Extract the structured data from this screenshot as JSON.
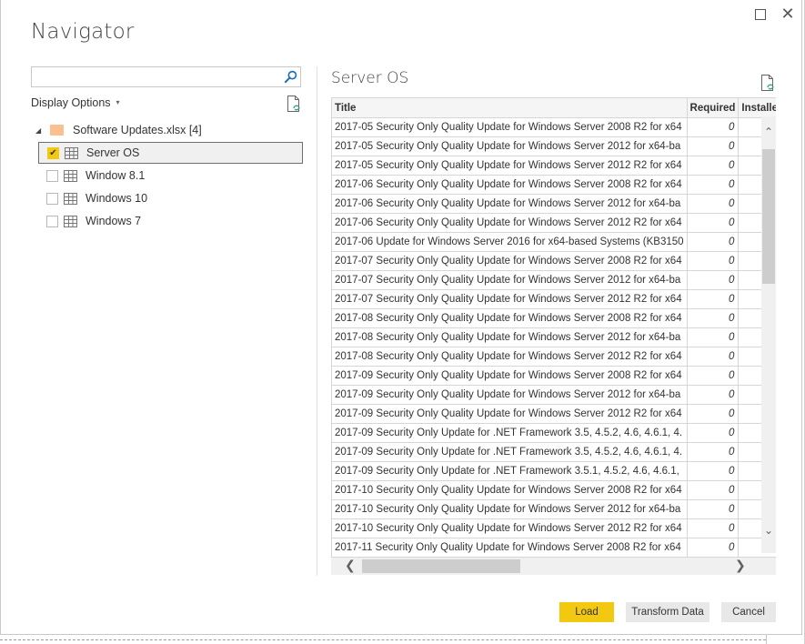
{
  "window": {
    "title": "Navigator",
    "maximize_icon": "maximize-icon",
    "close_icon": "close-icon"
  },
  "left_panel": {
    "search": {
      "value": "",
      "placeholder": "",
      "icon": "search-icon"
    },
    "display_options_label": "Display Options",
    "display_options_caret": "▾",
    "refresh_icon": "refresh-file-icon",
    "tree": {
      "root": {
        "label": "Software Updates.xlsx [4]",
        "expander": "◢",
        "icon": "folder-icon",
        "expanded": true
      },
      "items": [
        {
          "label": "Server OS",
          "checked": true,
          "selected": true,
          "icon": "table-icon"
        },
        {
          "label": "Window 8.1",
          "checked": false,
          "selected": false,
          "icon": "table-icon"
        },
        {
          "label": "Windows 10",
          "checked": false,
          "selected": false,
          "icon": "table-icon"
        },
        {
          "label": "Windows 7",
          "checked": false,
          "selected": false,
          "icon": "table-icon"
        }
      ]
    }
  },
  "preview": {
    "title": "Server OS",
    "refresh_icon": "refresh-file-icon",
    "columns": [
      "Title",
      "Required",
      "Installed"
    ],
    "rows": [
      [
        "2017-05 Security Only Quality Update for Windows Server 2008 R2 for x64",
        "0",
        ""
      ],
      [
        "2017-05 Security Only Quality Update for Windows Server 2012 for x64-ba",
        "0",
        ""
      ],
      [
        "2017-05 Security Only Quality Update for Windows Server 2012 R2 for x64",
        "0",
        ""
      ],
      [
        "2017-06 Security Only Quality Update for Windows Server 2008 R2 for x64",
        "0",
        ""
      ],
      [
        "2017-06 Security Only Quality Update for Windows Server 2012 for x64-ba",
        "0",
        ""
      ],
      [
        "2017-06 Security Only Quality Update for Windows Server 2012 R2 for x64",
        "0",
        ""
      ],
      [
        "2017-06 Update for Windows Server 2016 for x64-based Systems (KB3150",
        "0",
        ""
      ],
      [
        "2017-07 Security Only Quality Update for Windows Server 2008 R2 for x64",
        "0",
        ""
      ],
      [
        "2017-07 Security Only Quality Update for Windows Server 2012 for x64-ba",
        "0",
        ""
      ],
      [
        "2017-07 Security Only Quality Update for Windows Server 2012 R2 for x64",
        "0",
        ""
      ],
      [
        "2017-08 Security Only Quality Update for Windows Server 2008 R2 for x64",
        "0",
        ""
      ],
      [
        "2017-08 Security Only Quality Update for Windows Server 2012 for x64-ba",
        "0",
        ""
      ],
      [
        "2017-08 Security Only Quality Update for Windows Server 2012 R2 for x64",
        "0",
        ""
      ],
      [
        "2017-09 Security Only Quality Update for Windows Server 2008 R2 for x64",
        "0",
        ""
      ],
      [
        "2017-09 Security Only Quality Update for Windows Server 2012 for x64-ba",
        "0",
        ""
      ],
      [
        "2017-09 Security Only Quality Update for Windows Server 2012 R2 for x64",
        "0",
        ""
      ],
      [
        "2017-09 Security Only Update for .NET Framework 3.5, 4.5.2, 4.6, 4.6.1, 4.",
        "0",
        ""
      ],
      [
        "2017-09 Security Only Update for .NET Framework 3.5, 4.5.2, 4.6, 4.6.1, 4.",
        "0",
        ""
      ],
      [
        "2017-09 Security Only Update for .NET Framework 3.5.1, 4.5.2, 4.6, 4.6.1,",
        "0",
        ""
      ],
      [
        "2017-10 Security Only Quality Update for Windows Server 2008 R2 for x64",
        "0",
        ""
      ],
      [
        "2017-10 Security Only Quality Update for Windows Server 2012 for x64-ba",
        "0",
        ""
      ],
      [
        "2017-10 Security Only Quality Update for Windows Server 2012 R2 for x64",
        "0",
        ""
      ],
      [
        "2017-11 Security Only Quality Update for Windows Server 2008 R2 for x64",
        "0",
        ""
      ]
    ],
    "scroll_up": "⌃",
    "scroll_down": "⌄",
    "scroll_left": "❮",
    "scroll_right": "❯"
  },
  "footer": {
    "load_label": "Load",
    "transform_label": "Transform Data",
    "cancel_label": "Cancel"
  },
  "colors": {
    "accent": "#f2c811",
    "folder": "#fbc08f"
  }
}
